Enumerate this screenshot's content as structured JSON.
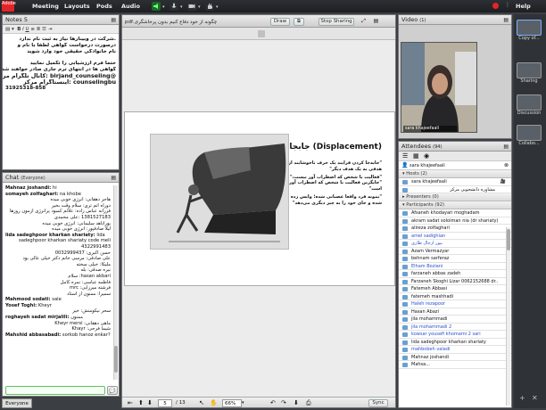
{
  "menubar": {
    "logo_text": "Adobe",
    "items": [
      "Meeting",
      "Layouts",
      "Pods",
      "Audio"
    ],
    "help": "Help"
  },
  "notes": {
    "title": "Notes 5",
    "lines": [
      ".شرکت در وبینارها نیاز به ثبت نام ندارد",
      "درصورت درخواست گواهی لطفا با نام و",
      "نام خانوادگی حقیقی خود وارد شوید",
      "",
      "حتما فرم ارزشیابی را تکمیل نمایید",
      "گواهی ها در انتهای ترم جاری صادر خواهند شد",
      "@birjand_counseling :کانال تلگرام مرکز",
      "counselingbu :اینستاگرام مرکز",
      "31925318-858"
    ]
  },
  "chat": {
    "title": "Chat",
    "scope": "(Everyone)",
    "lines": [
      {
        "name": "Mahnaz joshandi:",
        "text": " hi"
      },
      {
        "name": "somayeh zolfaghari:",
        "text": " na khobe"
      },
      {
        "name": "",
        "text": "هاجر دهقانی: انرژی خوبی میده"
      },
      {
        "name": "",
        "text": "دوراه اتم تری: سلام وقت بخیر"
      },
      {
        "name": "",
        "text": "فرزانه عباس زاده: علائم کمبود پرانرژی ازمون روزها"
      },
      {
        "name": "",
        "text": "1381527183 :علی محمدی"
      },
      {
        "name": "",
        "text": "پوراناهد سلیمانی: انرژی خوبی میده"
      },
      {
        "name": "",
        "text": "لیلا صادقپور: انرژی خوبی میده"
      },
      {
        "name": "lida sadeghpoor kharkan shariaty:",
        "text": " lida"
      },
      {
        "name": "",
        "text": "sadeghpoor kharkan shariaty code meli"
      },
      {
        "name": "",
        "text": "4322991483"
      },
      {
        "name": "",
        "text": "حسن اکبری: 0032999437"
      },
      {
        "name": "",
        "text": "علی صادقی: مرسی خانم دکتر خیلی عالی بود"
      },
      {
        "name": "",
        "text": "ملیکا: خیلی سخته"
      },
      {
        "name": "",
        "text": "نیره صدقی: بله"
      },
      {
        "name": "",
        "text": "hasan akbari: سلام"
      },
      {
        "name": "",
        "text": "فاطمه عباسی: نمره کامل"
      },
      {
        "name": "",
        "text": "فرشته میرزایی: mrc"
      },
      {
        "name": "",
        "text": "سمیرا: ممنون از استاد"
      },
      {
        "name": "Mahmood sodati:",
        "text": " sale"
      },
      {
        "name": "Yosef Toghi:",
        "text": " Kheyr"
      },
      {
        "name": "",
        "text": "سحر نیکومنش: خیر"
      },
      {
        "name": "roghayeh sadat mirjalili:",
        "text": " ممنون"
      },
      {
        "name": "",
        "text": "ماهی دهقانی: Kheyr mersi"
      },
      {
        "name": "",
        "text": "شیما فرجی: Khayr"
      },
      {
        "name": "Mahshid abbasabadi:",
        "text": " sorkob hanoz enkar?"
      }
    ],
    "send_label": "Everyone"
  },
  "share": {
    "title": "چگونه از خود دفاع کنیم بدون پرخاشگری.pdf",
    "draw_label": "Draw",
    "stop_label": "Stop Sharing",
    "page_current": "5",
    "page_total": "/ 13",
    "zoom": "66%",
    "sync_label": "Sync"
  },
  "slide": {
    "title": "(Displacement) جابجایی",
    "paragraphs": [
      "\"جابه‌جا کردن فرایند یک حرف ناخوشایند از هدفی به یک هدف دیگر\"",
      "\"فعالیت با شخص که اضطراب آور نیست،\"",
      "\"جایگزین فعالیت با شخص که اضطراب آور است\"",
      "\"نمونه فرد واقعا عصبانی شده؛ واپس زده شده و جای خود را به چیز دیگری می‌دهد\""
    ]
  },
  "video": {
    "title": "Video",
    "count": "(1)",
    "caption": "sara khajeefaali"
  },
  "attendees": {
    "title": "Attendees",
    "count": "(94)",
    "search_value": "sara khajeefaali",
    "hosts_label": "Hosts (2)",
    "hosts": [
      "sara khajeefaali",
      "مشاوره دانشجویی مرکز"
    ],
    "presenters_label": "Presenters (0)",
    "participants_label": "Participants (92)",
    "participants": [
      "Afsaneh khodayari moghadam",
      "akram sadat soloiman nia (dr shariaty)",
      "alireza zolfaghari",
      "amel sadighian",
      "بیور ارجال طاری",
      "Azam Vermazyar",
      "behnam sarferaz",
      "Elham Boziani",
      "farzaneh abbas zadeh",
      "Farzaneh Skoghi Lizar 0062152688 dr..",
      "Fatemeh Abbasi",
      "fatemeh mashhadi",
      "Haleh rezapoor",
      "Hasan Abazi",
      "jila mohammadi",
      "jila mohammadi 2",
      "kowsar yousefi khomami 2 sari",
      "lida sadeghpoor kharkan shariaty",
      "mahbobeh valadi",
      "Mahnaz joshandi",
      "Mahsa..."
    ]
  },
  "layouts": {
    "items": [
      "Copy of...",
      "Sharing",
      "Discussion",
      "Collabo..."
    ]
  },
  "status": {
    "tab": "Everyone"
  },
  "colors": {
    "brand": "#e32528",
    "chat_input_border": "#60c060",
    "participant_link": "#2a4fcc"
  }
}
